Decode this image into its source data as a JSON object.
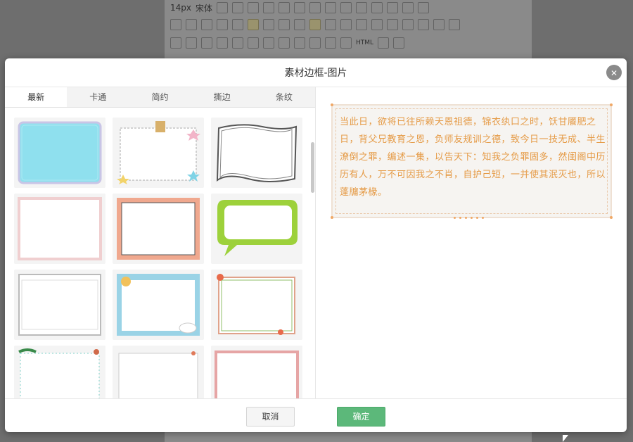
{
  "toolbar": {
    "font_size": "14px",
    "font_family": "宋体",
    "html_label": "HTML"
  },
  "dialog": {
    "title": "素材边框-图片",
    "close_glyph": "✕",
    "tabs": [
      "最新",
      "卡通",
      "简约",
      "撕边",
      "条纹"
    ],
    "active_tab": "最新",
    "frame_count_visible": 12,
    "preview_text": "当此日，欲将已往所赖天恩祖德，锦衣纨口之时，饫甘餍肥之日，背父兄教育之恩，负师友规训之德，致今日一技无成、半生潦倒之罪，编述一集，以告天下：知我之负罪固多，然闺阁中历历有人，万不可因我之不肖，自护己短，一并使其泯灭也，所以蓬牖茅椽。",
    "cancel_label": "取消",
    "ok_label": "确定"
  },
  "colors": {
    "overlay": "#6e6e6e",
    "preview_text": "#e59a45",
    "ok_button": "#5cb87a"
  }
}
